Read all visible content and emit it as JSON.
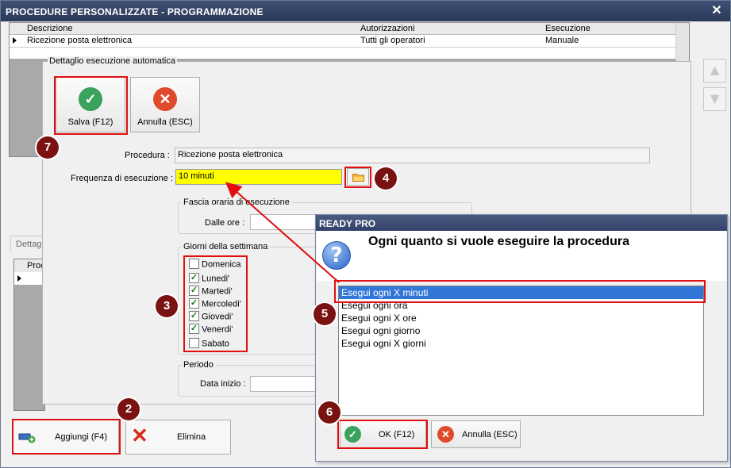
{
  "window": {
    "title": "PROCEDURE PERSONALIZZATE -  PROGRAMMAZIONE",
    "close_icon": "✕"
  },
  "grid": {
    "headers": [
      "Descrizione",
      "Autorizzazioni",
      "Esecuzione"
    ],
    "row": {
      "descrizione": "Ricezione posta elettronica",
      "autorizzazioni": "Tutti gli operatori",
      "esecuzione": "Manuale"
    }
  },
  "side_arrows": {
    "up_icon": "▲",
    "down_icon": "▼"
  },
  "lower": {
    "tab_label": "Dettag",
    "grid_header": "Proc"
  },
  "bottom_buttons": {
    "aggiungi": "Aggiungi (F4)",
    "elimina": "Elimina"
  },
  "detail": {
    "legend": "Dettaglio esecuzione automatica",
    "save_label": "Salva (F12)",
    "cancel_label": "Annulla (ESC)",
    "procedura_label": "Procedura :",
    "procedura_value": "Ricezione posta elettronica",
    "frequenza_label": "Frequenza di esecuzione :",
    "frequenza_value": "10 minuti",
    "fascia_title": "Fascia oraria di esecuzione",
    "dalle_ore_label": "Dalle ore :",
    "giorni_title": "Giorni della settimana",
    "days": [
      {
        "label": "Domenica",
        "checked": false
      },
      {
        "label": "Lunedi'",
        "checked": true
      },
      {
        "label": "Martedi'",
        "checked": true
      },
      {
        "label": "Mercoledi'",
        "checked": true
      },
      {
        "label": "Giovedi'",
        "checked": true
      },
      {
        "label": "Venerdi'",
        "checked": true
      },
      {
        "label": "Sabato",
        "checked": false
      }
    ],
    "periodo_title": "Periodo",
    "data_inizio_label": "Data inizio :"
  },
  "popup": {
    "title": "READY PRO",
    "question": "Ogni quanto si vuole eseguire la procedura",
    "options": [
      "Esegui ogni X minuti",
      "Esegui ogni ora",
      "Esegui ogni X ore",
      "Esegui ogni giorno",
      "Esegui ogni X giorni"
    ],
    "selected_index": 0,
    "ok_label": "OK (F12)",
    "cancel_label": "Annulla (ESC)"
  },
  "annotations": {
    "badges": [
      "2",
      "3",
      "4",
      "5",
      "6",
      "7"
    ]
  },
  "colors": {
    "highlight": "#ffff00",
    "annotation_red": "#e10f0f",
    "badge": "#7a1212",
    "selection": "#3176d6"
  }
}
